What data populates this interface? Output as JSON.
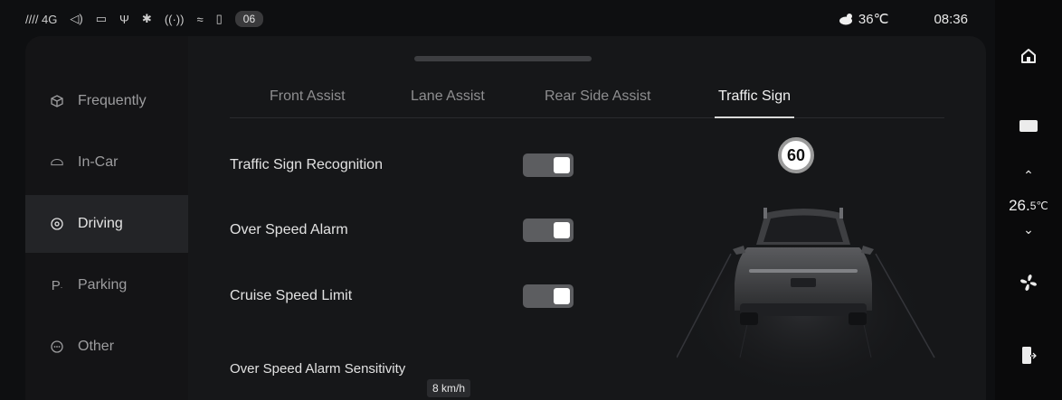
{
  "status_bar": {
    "signal": "//// 4G",
    "badge": "06",
    "weather_temp": "36℃",
    "time": "08:36"
  },
  "menu": {
    "items": [
      {
        "label": "Frequently",
        "icon": "cube-icon"
      },
      {
        "label": "In-Car",
        "icon": "car-outline-icon"
      },
      {
        "label": "Driving",
        "icon": "steering-wheel-icon",
        "active": true
      },
      {
        "label": "Parking",
        "icon": "parking-icon"
      },
      {
        "label": "Other",
        "icon": "more-icon"
      }
    ]
  },
  "tabs": [
    {
      "label": "Front Assist"
    },
    {
      "label": "Lane Assist"
    },
    {
      "label": "Rear Side Assist"
    },
    {
      "label": "Traffic Sign",
      "active": true
    }
  ],
  "settings": [
    {
      "label": "Traffic Sign Recognition",
      "enabled": true
    },
    {
      "label": "Over Speed Alarm",
      "enabled": true
    },
    {
      "label": "Cruise Speed Limit",
      "enabled": true
    }
  ],
  "sensitivity": {
    "label": "Over Speed Alarm Sensitivity",
    "value": "8 km/h"
  },
  "speed_sign": "60",
  "climate": {
    "temp": "26.",
    "temp_small": "5℃"
  },
  "colors": {
    "background": "#0e0f11",
    "panel": "#161719",
    "toggle_on": "#5c5d60"
  }
}
